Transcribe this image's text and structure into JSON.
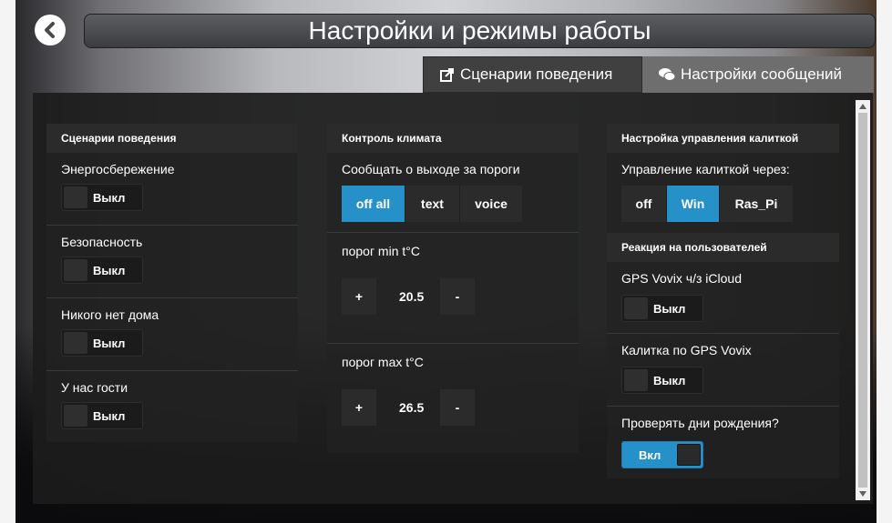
{
  "header": {
    "title": "Настройки и режимы работы"
  },
  "tabs": [
    {
      "label": "Сценарии поведения",
      "icon": "share-icon"
    },
    {
      "label": "Настройки сообщений",
      "icon": "chat-icon"
    }
  ],
  "behavior": {
    "title": "Сценарии поведения",
    "items": [
      {
        "label": "Энергосбережение",
        "state": "Выкл"
      },
      {
        "label": "Безопасность",
        "state": "Выкл"
      },
      {
        "label": "Никого нет дома",
        "state": "Выкл"
      },
      {
        "label": "У нас гости",
        "state": "Выкл"
      }
    ]
  },
  "climate": {
    "title": "Контроль климата",
    "notify_label": "Сообщать о выходе за пороги",
    "notify_options": [
      "off all",
      "text",
      "voice"
    ],
    "notify_selected": "off all",
    "min_label": "порог min t°C",
    "min_value": "20.5",
    "max_label": "порог max t°C",
    "max_value": "26.5",
    "plus": "+",
    "minus": "-"
  },
  "gate": {
    "title": "Настройка управления калиткой",
    "control_label": "Управление калиткой через:",
    "options": [
      "off",
      "Win",
      "Ras_Pi"
    ],
    "selected": "Win",
    "reaction_title": "Реакция на пользователей",
    "items": [
      {
        "label": "GPS Vovix ч/з iCloud",
        "state": "Выкл"
      },
      {
        "label": "Калитка по GPS Vovix",
        "state": "Выкл"
      },
      {
        "label": "Проверять дни рождения?",
        "state": "Вкл"
      }
    ]
  },
  "colors": {
    "accent": "#2691c8",
    "panel": "#1c1c1c"
  }
}
